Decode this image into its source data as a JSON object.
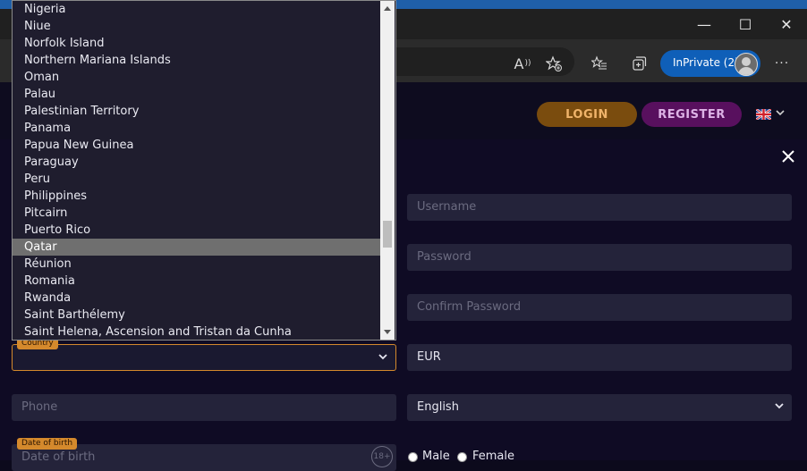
{
  "browser": {
    "read_aloud_icon": "A",
    "inprivate_label": "InPrivate (2)",
    "minimize": "—",
    "maximize": "☐",
    "close": "✕",
    "more": "···"
  },
  "header": {
    "login_label": "LOGIN",
    "register_label": "REGISTER",
    "language_flag": "uk-flag-icon"
  },
  "dropdown": {
    "items": [
      "Nigeria",
      "Niue",
      "Norfolk Island",
      "Northern Mariana Islands",
      "Oman",
      "Palau",
      "Palestinian Territory",
      "Panama",
      "Papua New Guinea",
      "Paraguay",
      "Peru",
      "Philippines",
      "Pitcairn",
      "Puerto Rico",
      "Qatar",
      "Réunion",
      "Romania",
      "Rwanda",
      "Saint Barthélemy",
      "Saint Helena, Ascension and Tristan da Cunha"
    ],
    "highlighted": "Qatar"
  },
  "form": {
    "username_placeholder": "Username",
    "password_placeholder": "Password",
    "confirm_password_placeholder": "Confirm Password",
    "country_label": "Country",
    "country_value": "",
    "currency_value": "EUR",
    "phone_placeholder": "Phone",
    "language_value": "English",
    "dob_label": "Date of birth",
    "dob_placeholder": "Date of birth",
    "age_badge": "18+",
    "gender_male": "Male",
    "gender_female": "Female"
  },
  "colors": {
    "login_bg": "#7a4c0e",
    "register_bg": "#58105e",
    "accent_orange": "#d4892c",
    "inprivate_blue": "#0f5fb8"
  }
}
